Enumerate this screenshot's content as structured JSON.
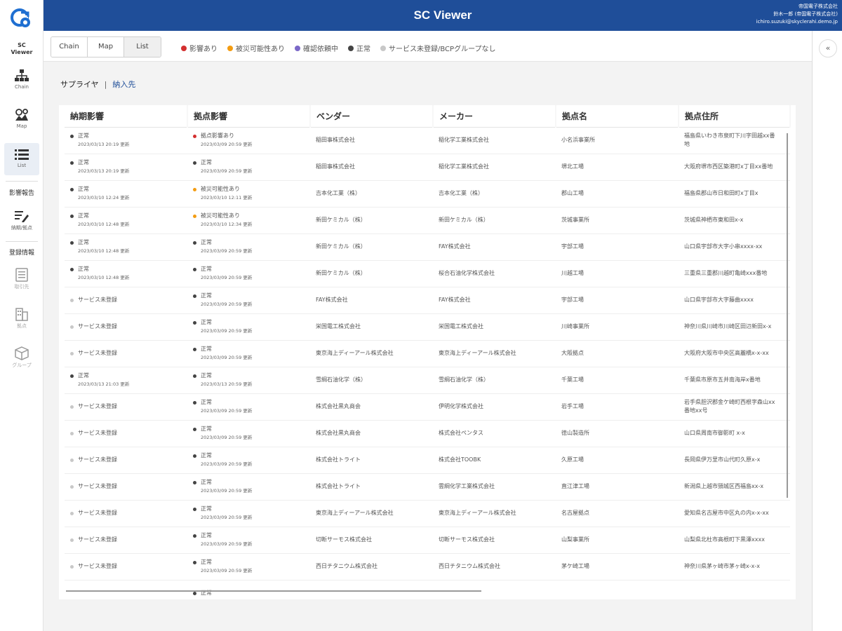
{
  "header": {
    "title": "SC Viewer",
    "user_company": "帝国電子株式会社",
    "user_name": "鈴木一郎 (帝国電子株式会社)",
    "user_email": "ichiro.suzuki@skyclerahi.demo.jp"
  },
  "sidebar": {
    "app_name_line1": "SC",
    "app_name_line2": "Viewer",
    "nav": [
      {
        "label": "Chain"
      },
      {
        "label": "Map"
      },
      {
        "label": "List"
      }
    ],
    "section_impact": "影響報告",
    "impact_item": "納期/拠点",
    "section_register": "登録情報",
    "register_items": [
      {
        "label": "取引先"
      },
      {
        "label": "拠点"
      },
      {
        "label": "グループ"
      }
    ]
  },
  "toolbar": {
    "views": [
      "Chain",
      "Map",
      "List"
    ],
    "legend": [
      {
        "label": "影響あり",
        "color": "#d32f2f"
      },
      {
        "label": "被災可能性あり",
        "color": "#f39c12"
      },
      {
        "label": "確認依頼中",
        "color": "#7b68c8"
      },
      {
        "label": "正常",
        "color": "#444444"
      },
      {
        "label": "サービス未登録/BCPグループなし",
        "color": "#c8c8c8"
      }
    ]
  },
  "subtabs": {
    "active": "サプライヤ",
    "separator": "|",
    "other": "納入先"
  },
  "right_panel": {
    "collapse_label": "«"
  },
  "table": {
    "columns": [
      "納期影響",
      "拠点影響",
      "ベンダー",
      "メーカー",
      "拠点名",
      "拠点住所"
    ],
    "rows": [
      {
        "delivery": "正常",
        "delivery_time": "2023/03/13 20:19 更新",
        "delivery_color": "#444444",
        "site": "拠点影響あり",
        "site_time": "2023/03/09 20:59 更新",
        "site_color": "#d32f2f",
        "vendor": "稲田事株式会社",
        "maker": "稲化学工業株式会社",
        "site_name": "小名浜事業所",
        "address": "福島県いわき市泉町下川字田越xx番地"
      },
      {
        "delivery": "正常",
        "delivery_time": "2023/03/13 20:19 更新",
        "delivery_color": "#444444",
        "site": "正常",
        "site_time": "2023/03/09 20:59 更新",
        "site_color": "#444444",
        "vendor": "稲田事株式会社",
        "maker": "稲化学工業株式会社",
        "site_name": "堺北工場",
        "address": "大阪府堺市西区築港町x丁目xx番地"
      },
      {
        "delivery": "正常",
        "delivery_time": "2023/03/10 12:24 更新",
        "delivery_color": "#444444",
        "site": "被災可能性あり",
        "site_time": "2023/03/10 12:11 更新",
        "site_color": "#f39c12",
        "vendor": "吉本化工業（株）",
        "maker": "吉本化工業（株）",
        "site_name": "郡山工場",
        "address": "福島県郡山市日和田町x丁目x"
      },
      {
        "delivery": "正常",
        "delivery_time": "2023/03/10 12:48 更新",
        "delivery_color": "#444444",
        "site": "被災可能性あり",
        "site_time": "2023/03/10 12:34 更新",
        "site_color": "#f39c12",
        "vendor": "新田ケミカル（株）",
        "maker": "新田ケミカル（株）",
        "site_name": "茨城事業所",
        "address": "茨城県神栖市東和田x-x"
      },
      {
        "delivery": "正常",
        "delivery_time": "2023/03/10 12:48 更新",
        "delivery_color": "#444444",
        "site": "正常",
        "site_time": "2023/03/09 20:59 更新",
        "site_color": "#444444",
        "vendor": "新田ケミカル（株）",
        "maker": "FAY株式会社",
        "site_name": "宇部工場",
        "address": "山口県宇部市大字小串xxxx-xx"
      },
      {
        "delivery": "正常",
        "delivery_time": "2023/03/10 12:48 更新",
        "delivery_color": "#444444",
        "site": "正常",
        "site_time": "2023/03/09 20:59 更新",
        "site_color": "#444444",
        "vendor": "新田ケミカル（株）",
        "maker": "桜合石油化学株式会社",
        "site_name": "川越工場",
        "address": "三重県三重郡川越町亀崎xxx番地"
      },
      {
        "delivery": "サービス未登録",
        "delivery_time": "",
        "delivery_color": "#c8c8c8",
        "site": "正常",
        "site_time": "2023/03/09 20:59 更新",
        "site_color": "#444444",
        "vendor": "FAY株式会社",
        "maker": "FAY株式会社",
        "site_name": "宇部工場",
        "address": "山口県宇部市大字藤曲xxxx"
      },
      {
        "delivery": "サービス未登録",
        "delivery_time": "",
        "delivery_color": "#c8c8c8",
        "site": "正常",
        "site_time": "2023/03/09 20:59 更新",
        "site_color": "#444444",
        "vendor": "栄国電工株式会社",
        "maker": "栄国電工株式会社",
        "site_name": "川崎事業所",
        "address": "神奈川県川崎市川崎区田辺新田x-x"
      },
      {
        "delivery": "サービス未登録",
        "delivery_time": "",
        "delivery_color": "#c8c8c8",
        "site": "正常",
        "site_time": "2023/03/09 20:59 更新",
        "site_color": "#444444",
        "vendor": "東京海上ディーアール株式会社",
        "maker": "東京海上ディーアール株式会社",
        "site_name": "大阪拠点",
        "address": "大阪府大阪市中央区高麗橋x-x-xx"
      },
      {
        "delivery": "正常",
        "delivery_time": "2023/03/13 21:03 更新",
        "delivery_color": "#444444",
        "site": "正常",
        "site_time": "2023/03/13 20:59 更新",
        "site_color": "#444444",
        "vendor": "雪綱石油化学（株）",
        "maker": "雪綱石油化学（株）",
        "site_name": "千葉工場",
        "address": "千葉県市原市五井南海岸x番地"
      },
      {
        "delivery": "サービス未登録",
        "delivery_time": "",
        "delivery_color": "#c8c8c8",
        "site": "正常",
        "site_time": "2023/03/09 20:59 更新",
        "site_color": "#444444",
        "vendor": "株式会社黒丸商会",
        "maker": "伊明化学株式会社",
        "site_name": "岩手工場",
        "address": "岩手県胆沢郡金ケ崎町西根字森山xx番地xx号"
      },
      {
        "delivery": "サービス未登録",
        "delivery_time": "",
        "delivery_color": "#c8c8c8",
        "site": "正常",
        "site_time": "2023/03/09 20:59 更新",
        "site_color": "#444444",
        "vendor": "株式会社黒丸商会",
        "maker": "株式会社ペンタス",
        "site_name": "徳山製造所",
        "address": "山口県周南市御影町 x-x"
      },
      {
        "delivery": "サービス未登録",
        "delivery_time": "",
        "delivery_color": "#c8c8c8",
        "site": "正常",
        "site_time": "2023/03/09 20:59 更新",
        "site_color": "#444444",
        "vendor": "株式会社トライト",
        "maker": "株式会社TOOBK",
        "site_name": "久原工場",
        "address": "長岡県伊万里市山代町久原x-x"
      },
      {
        "delivery": "サービス未登録",
        "delivery_time": "",
        "delivery_color": "#c8c8c8",
        "site": "正常",
        "site_time": "2023/03/09 20:59 更新",
        "site_color": "#444444",
        "vendor": "株式会社トライト",
        "maker": "雲綱化学工業株式会社",
        "site_name": "直江津工場",
        "address": "新潟県上越市頸城区西福島xx-x"
      },
      {
        "delivery": "サービス未登録",
        "delivery_time": "",
        "delivery_color": "#c8c8c8",
        "site": "正常",
        "site_time": "2023/03/09 20:59 更新",
        "site_color": "#444444",
        "vendor": "東京海上ディーアール株式会社",
        "maker": "東京海上ディーアール株式会社",
        "site_name": "名古屋拠点",
        "address": "愛知県名古屋市中区丸の内x-x-xx"
      },
      {
        "delivery": "サービス未登録",
        "delivery_time": "",
        "delivery_color": "#c8c8c8",
        "site": "正常",
        "site_time": "2023/03/09 20:59 更新",
        "site_color": "#444444",
        "vendor": "切断サーモス株式会社",
        "maker": "切断サーモス株式会社",
        "site_name": "山梨事業所",
        "address": "山梨県北杜市高根町下黒澤xxxx"
      },
      {
        "delivery": "サービス未登録",
        "delivery_time": "",
        "delivery_color": "#c8c8c8",
        "site": "正常",
        "site_time": "2023/03/09 20:59 更新",
        "site_color": "#444444",
        "vendor": "西日チタニウム株式会社",
        "maker": "西日チタニウム株式会社",
        "site_name": "茅ケ崎工場",
        "address": "神奈川県茅ヶ崎市茅ヶ崎x-x-x"
      },
      {
        "delivery": "",
        "delivery_time": "",
        "delivery_color": "#ffffff",
        "site": "正常",
        "site_time": "",
        "site_color": "#444444",
        "vendor": "",
        "maker": "",
        "site_name": "",
        "address": ""
      }
    ]
  }
}
